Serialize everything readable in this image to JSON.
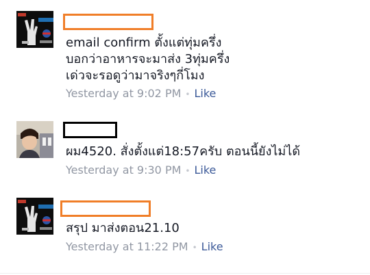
{
  "comments": [
    {
      "lines": [
        "email confirm ตั้งแต่ทุ่มครึ่ง",
        "บอกว่าอาหารจะมาส่ง 3ทุ่มครึ่ง",
        "เด่วจะรอดูว่ามาจริงๆกี่โมง"
      ],
      "timestamp": "Yesterday at 9:02 PM",
      "separator": "•",
      "like_label": "Like"
    },
    {
      "lines": [
        "ผม4520. สั่งตั้งแต่18:57ครับ ตอนนี้ยังไม่ได้"
      ],
      "timestamp": "Yesterday at 9:30 PM",
      "separator": "•",
      "like_label": "Like"
    },
    {
      "lines": [
        "สรุป มาส่งตอน21.10"
      ],
      "timestamp": "Yesterday at 11:22 PM",
      "separator": "•",
      "like_label": "Like"
    }
  ],
  "colors": {
    "redaction_orange": "#f07e28",
    "redaction_black": "#000000",
    "link_blue": "#3b5998",
    "meta_gray": "#9197a3"
  }
}
